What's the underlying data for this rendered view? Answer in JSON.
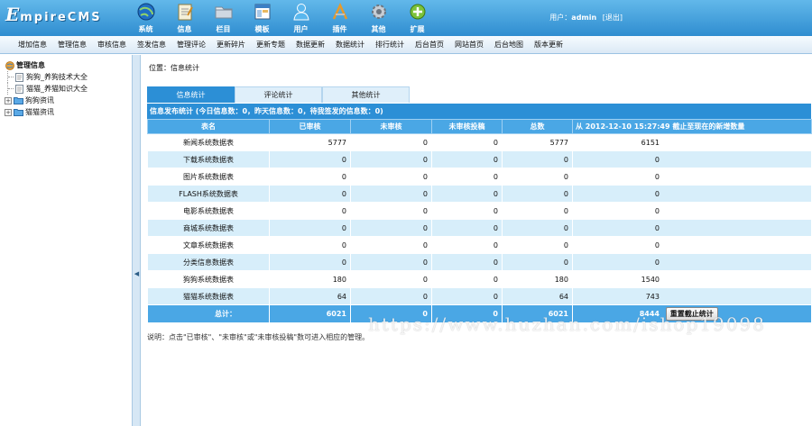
{
  "header": {
    "logo_main": "E",
    "logo_rest": "mpireCMS",
    "nav": [
      {
        "label": "系统",
        "icon": "globe-icon"
      },
      {
        "label": "信息",
        "icon": "notepad-icon"
      },
      {
        "label": "栏目",
        "icon": "folder-icon"
      },
      {
        "label": "模板",
        "icon": "template-window-icon"
      },
      {
        "label": "用户",
        "icon": "user-icon"
      },
      {
        "label": "插件",
        "icon": "tools-icon"
      },
      {
        "label": "其他",
        "icon": "gear-icon"
      },
      {
        "label": "扩展",
        "icon": "plus-circle-icon"
      }
    ],
    "user_label": "用户：",
    "username": "admin",
    "logout": "[退出]"
  },
  "menubar": [
    "增加信息",
    "管理信息",
    "审核信息",
    "签发信息",
    "管理评论",
    "更新碎片",
    "更新专题",
    "数据更新",
    "数据统计",
    "排行统计",
    "后台首页",
    "网站首页",
    "后台地图",
    "版本更新"
  ],
  "sidebar": {
    "root": "管理信息",
    "items": [
      {
        "label": "狗狗_养狗技术大全",
        "type": "doc",
        "indent": 1
      },
      {
        "label": "猫猫_养猫知识大全",
        "type": "doc",
        "indent": 1
      },
      {
        "label": "狗狗资讯",
        "type": "folder",
        "indent": 0
      },
      {
        "label": "猫猫资讯",
        "type": "folder",
        "indent": 0
      }
    ]
  },
  "main": {
    "location": "位置：信息统计",
    "tabs": [
      "信息统计",
      "评论统计",
      "其他统计"
    ],
    "summary": "信息发布统计 (今日信息数：0，昨天信息数：0，待我签发的信息数：0)",
    "columns": [
      "表名",
      "已审核",
      "未审核",
      "未审核投稿",
      "总数",
      "从 2012-12-10 15:27:49 截止至现在的新增数量"
    ],
    "rows": [
      {
        "name": "新闻系统数据表",
        "checked": "5777",
        "unchecked": "0",
        "pending": "0",
        "total": "5777",
        "new": "6151"
      },
      {
        "name": "下载系统数据表",
        "checked": "0",
        "unchecked": "0",
        "pending": "0",
        "total": "0",
        "new": "0"
      },
      {
        "name": "图片系统数据表",
        "checked": "0",
        "unchecked": "0",
        "pending": "0",
        "total": "0",
        "new": "0"
      },
      {
        "name": "FLASH系统数据表",
        "checked": "0",
        "unchecked": "0",
        "pending": "0",
        "total": "0",
        "new": "0"
      },
      {
        "name": "电影系统数据表",
        "checked": "0",
        "unchecked": "0",
        "pending": "0",
        "total": "0",
        "new": "0"
      },
      {
        "name": "商城系统数据表",
        "checked": "0",
        "unchecked": "0",
        "pending": "0",
        "total": "0",
        "new": "0"
      },
      {
        "name": "文章系统数据表",
        "checked": "0",
        "unchecked": "0",
        "pending": "0",
        "total": "0",
        "new": "0"
      },
      {
        "name": "分类信息数据表",
        "checked": "0",
        "unchecked": "0",
        "pending": "0",
        "total": "0",
        "new": "0"
      },
      {
        "name": "狗狗系统数据表",
        "checked": "180",
        "unchecked": "0",
        "pending": "0",
        "total": "180",
        "new": "1540"
      },
      {
        "name": "猫猫系统数据表",
        "checked": "64",
        "unchecked": "0",
        "pending": "0",
        "total": "64",
        "new": "743"
      }
    ],
    "totals": {
      "label": "总计：",
      "checked": "6021",
      "unchecked": "0",
      "pending": "0",
      "total": "6021",
      "new": "8444",
      "reset_button": "重置截止统计"
    },
    "note": "说明：点击\"已审核\"、\"未审核\"或\"未审核投稿\"数可进入相应的管理。"
  },
  "watermark": "https://www.huzhan.com/ishop19098",
  "colors": {
    "header_blue": "#2f8dd0",
    "tab_active": "#2c8fd6",
    "row_alt": "#d7eefa",
    "th_blue": "#4aa7e5"
  }
}
